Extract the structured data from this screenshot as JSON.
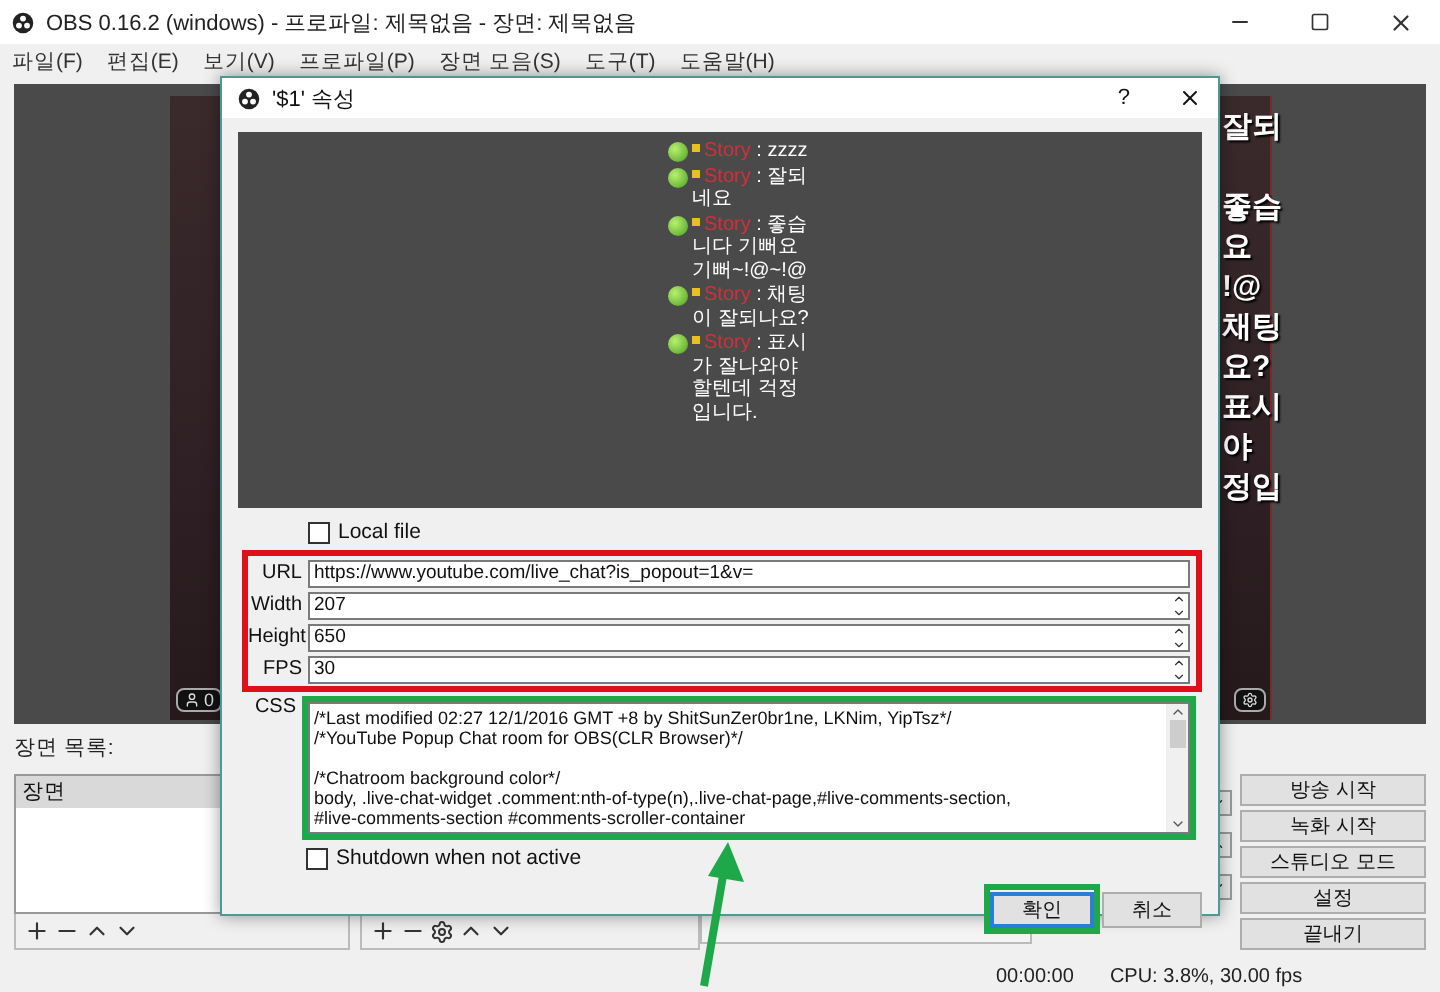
{
  "window": {
    "title": "OBS 0.16.2 (windows) - 프로파일: 제목없음 - 장면: 제목없음"
  },
  "menu": [
    "파일(F)",
    "편집(E)",
    "보기(V)",
    "프로파일(P)",
    "장면 모음(S)",
    "도구(T)",
    "도움말(H)"
  ],
  "preview": {
    "chat_fragments": [
      "잘되",
      "좋습",
      "요",
      "!@",
      "채팅",
      "요?",
      "표시",
      "야",
      "정입"
    ],
    "viewer_count": "0"
  },
  "scenes": {
    "label": "장면 목록:",
    "items": [
      {
        "name": "장면",
        "selected": true
      }
    ]
  },
  "controls": [
    "방송 시작",
    "녹화 시작",
    "스튜디오 모드",
    "설정",
    "끝내기"
  ],
  "status_bar": {
    "time": "00:00:00",
    "cpu": "CPU: 3.8%, 30.00 fps"
  },
  "dialog": {
    "title": "'$1' 속성",
    "help": "?",
    "chat": [
      {
        "user": "Story",
        "separator": " : ",
        "message": "zzzz"
      },
      {
        "user": "Story",
        "separator": " : ",
        "message": "잘되네요"
      },
      {
        "user": "Story",
        "separator": " : ",
        "message": "좋습니다 기뻐요 기뻐~!@~!@"
      },
      {
        "user": "Story",
        "separator": " : ",
        "message": "채팅이 잘되나요?"
      },
      {
        "user": "Story",
        "separator": " : ",
        "message": "표시가 잘나와야 할텐데 걱정입니다."
      }
    ],
    "local_file": {
      "label": "Local file",
      "checked": false
    },
    "fields": [
      {
        "label": "URL",
        "value": "https://www.youtube.com/live_chat?is_popout=1&v=",
        "kind": "text"
      },
      {
        "label": "Width",
        "value": "207",
        "kind": "spin"
      },
      {
        "label": "Height",
        "value": "650",
        "kind": "spin"
      },
      {
        "label": "FPS",
        "value": "30",
        "kind": "spin"
      }
    ],
    "css": {
      "label": "CSS",
      "value": "/*Last modified 02:27 12/1/2016 GMT +8 by ShitSunZer0br1ne, LKNim, YipTsz*/\n/*YouTube Popup Chat room for OBS(CLR Browser)*/\n\n/*Chatroom background color*/\nbody, .live-chat-widget .comment:nth-of-type(n),.live-chat-page,#live-comments-section,\n#live-comments-section #comments-scroller-container"
    },
    "shutdown": {
      "label": "Shutdown when not active",
      "checked": false
    },
    "buttons": [
      {
        "label": "확인",
        "default": true
      },
      {
        "label": "취소",
        "default": false
      }
    ]
  }
}
